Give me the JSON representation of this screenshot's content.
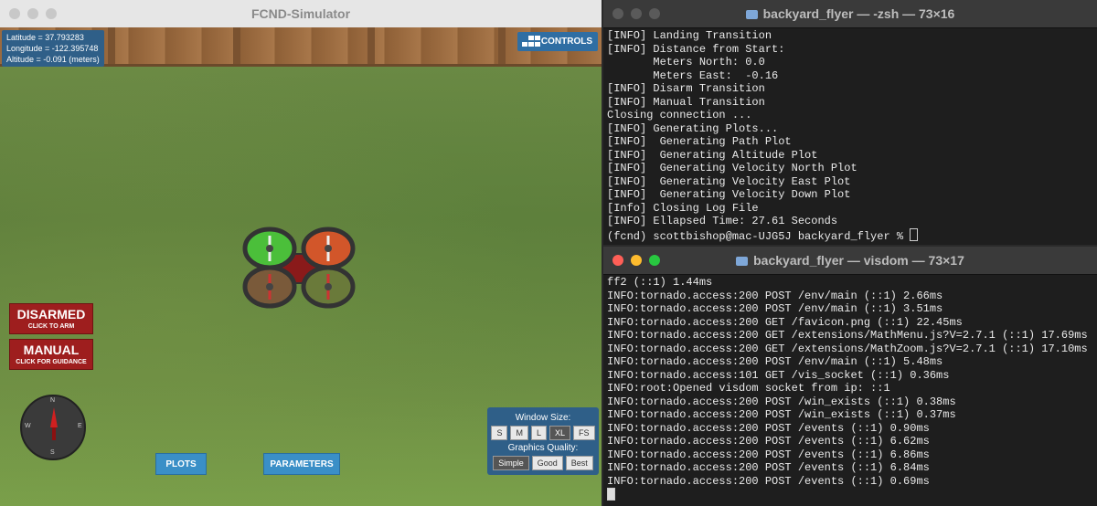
{
  "simulator": {
    "title": "FCND-Simulator",
    "latitude": "Latitude = 37.793283",
    "longitude": "Longitude = -122.395748",
    "altitude": "Altitude = -0.091 (meters)",
    "controls_label": "CONTROLS",
    "disarmed_label": "DISARMED",
    "disarmed_sub": "CLICK TO ARM",
    "manual_label": "MANUAL",
    "manual_sub": "CLICK FOR GUIDANCE",
    "compass": {
      "n": "N",
      "s": "S",
      "e": "E",
      "w": "W"
    },
    "plots_label": "PLOTS",
    "parameters_label": "PARAMETERS",
    "window_size_label": "Window Size:",
    "window_sizes": [
      "S",
      "M",
      "L",
      "XL",
      "FS"
    ],
    "graphics_quality_label": "Graphics Quality:",
    "graphics_qualities": [
      "Simple",
      "Good",
      "Best"
    ]
  },
  "terminal1": {
    "title": "backyard_flyer — -zsh — 73×16",
    "lines": [
      "[INFO] Landing Transition",
      "[INFO] Distance from Start:",
      "       Meters North: 0.0",
      "       Meters East:  -0.16",
      "[INFO] Disarm Transition",
      "[INFO] Manual Transition",
      "Closing connection ...",
      "[INFO] Generating Plots...",
      "[INFO]  Generating Path Plot",
      "[INFO]  Generating Altitude Plot",
      "[INFO]  Generating Velocity North Plot",
      "[INFO]  Generating Velocity East Plot",
      "[INFO]  Generating Velocity Down Plot",
      "[Info] Closing Log File",
      "[INFO] Ellapsed Time: 27.61 Seconds"
    ],
    "prompt": "(fcnd) scottbishop@mac-UJG5J backyard_flyer % "
  },
  "terminal2": {
    "title": "backyard_flyer — visdom — 73×17",
    "lines": [
      "ff2 (::1) 1.44ms",
      "INFO:tornado.access:200 POST /env/main (::1) 2.66ms",
      "INFO:tornado.access:200 POST /env/main (::1) 3.51ms",
      "INFO:tornado.access:200 GET /favicon.png (::1) 22.45ms",
      "INFO:tornado.access:200 GET /extensions/MathMenu.js?V=2.7.1 (::1) 17.69ms",
      "INFO:tornado.access:200 GET /extensions/MathZoom.js?V=2.7.1 (::1) 17.10ms",
      "INFO:tornado.access:200 POST /env/main (::1) 5.48ms",
      "INFO:tornado.access:101 GET /vis_socket (::1) 0.36ms",
      "INFO:root:Opened visdom socket from ip: ::1",
      "INFO:tornado.access:200 POST /win_exists (::1) 0.38ms",
      "INFO:tornado.access:200 POST /win_exists (::1) 0.37ms",
      "INFO:tornado.access:200 POST /events (::1) 0.90ms",
      "INFO:tornado.access:200 POST /events (::1) 6.62ms",
      "INFO:tornado.access:200 POST /events (::1) 6.86ms",
      "INFO:tornado.access:200 POST /events (::1) 6.84ms",
      "INFO:tornado.access:200 POST /events (::1) 0.69ms"
    ]
  },
  "colors": {
    "traffic_red": "#ff5f57",
    "traffic_yellow": "#febc2e",
    "traffic_green": "#28c840",
    "arm_button": "#9e1e1e",
    "panel_blue": "#2f5f88"
  }
}
